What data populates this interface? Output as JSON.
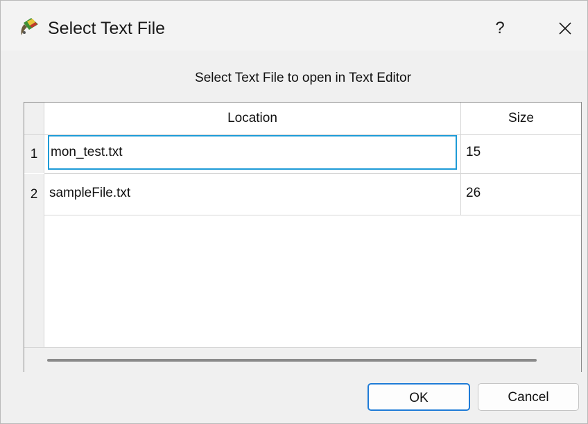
{
  "window": {
    "title": "Select Text File",
    "help_label": "?",
    "close_label": "✕"
  },
  "dialog": {
    "caption": "Select Text File to open in Text Editor"
  },
  "table": {
    "columns": [
      "Location",
      "Size"
    ],
    "rows": [
      {
        "row_num": "1",
        "location": "mon_test.txt",
        "size": "15",
        "editing": true
      },
      {
        "row_num": "2",
        "location": "sampleFile.txt",
        "size": "26",
        "editing": false
      }
    ]
  },
  "buttons": {
    "ok_label": "OK",
    "cancel_label": "Cancel"
  },
  "icons": {
    "app_icon": "paint-brush-icon",
    "close_icon": "close-icon"
  },
  "colors": {
    "focus_blue": "#1e9bd7",
    "ok_border": "#1e7bd7"
  }
}
